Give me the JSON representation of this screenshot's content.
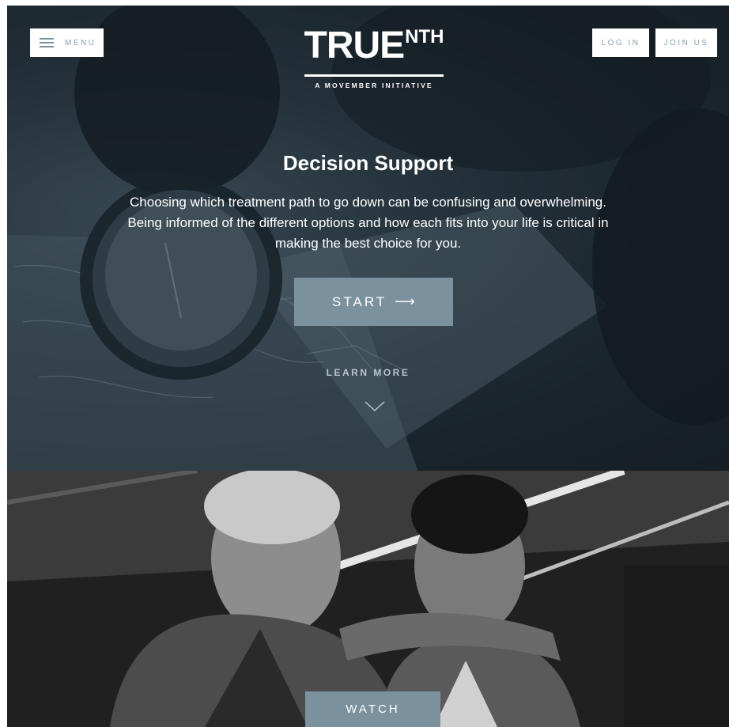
{
  "header": {
    "menu_label": "MENU",
    "logo": {
      "main": "TRUE",
      "superscript": "NTH",
      "tagline": "A MOVEMBER INITIATIVE"
    },
    "login_label": "LOG IN",
    "joinus_label": "JOIN US"
  },
  "hero": {
    "title": "Decision Support",
    "description": "Choosing which treatment path to go down can be confusing and overwhelming. Being informed of the different options and how each fits into your life is critical in making the best choice for you.",
    "start_label": "START",
    "start_arrow": "⟶",
    "learn_more_label": "LEARN MORE"
  },
  "video": {
    "watch_label": "WATCH"
  },
  "colors": {
    "accent": "#7b929e",
    "hero_dark": "#1c262d",
    "text_light": "#ffffff"
  },
  "icons": [
    "hamburger-icon",
    "arrow-right-icon",
    "chevron-down-icon"
  ]
}
